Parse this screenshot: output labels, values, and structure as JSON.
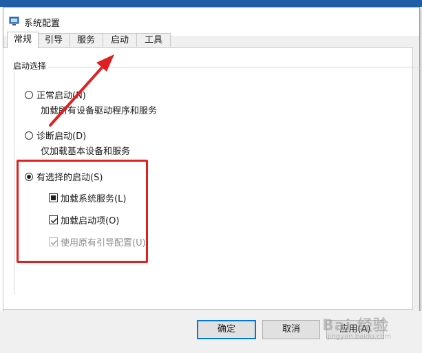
{
  "window": {
    "title": "系统配置",
    "icon": "msconfig-icon"
  },
  "tabs": [
    {
      "label": "常规",
      "active": true
    },
    {
      "label": "引导",
      "active": false
    },
    {
      "label": "服务",
      "active": false
    },
    {
      "label": "启动",
      "active": false
    },
    {
      "label": "工具",
      "active": false
    }
  ],
  "general": {
    "group_label": "启动选择",
    "normal": {
      "label": "正常启动(N)",
      "desc": "加载所有设备驱动程序和服务"
    },
    "diagnostic": {
      "label": "诊断启动(D)",
      "desc": "仅加载基本设备和服务"
    },
    "selective": {
      "label": "有选择的启动(S)",
      "load_services": "加载系统服务(L)",
      "load_startup": "加载启动项(O)",
      "use_original_boot": "使用原有引导配置(U)"
    }
  },
  "buttons": {
    "ok": "确定",
    "cancel": "取消",
    "apply": "应用(A)"
  },
  "watermark": {
    "text": "Bai 经验",
    "sub": "jingyan.baidu.com"
  },
  "colors": {
    "annotation": "#e02020",
    "accent": "#0078d7"
  }
}
